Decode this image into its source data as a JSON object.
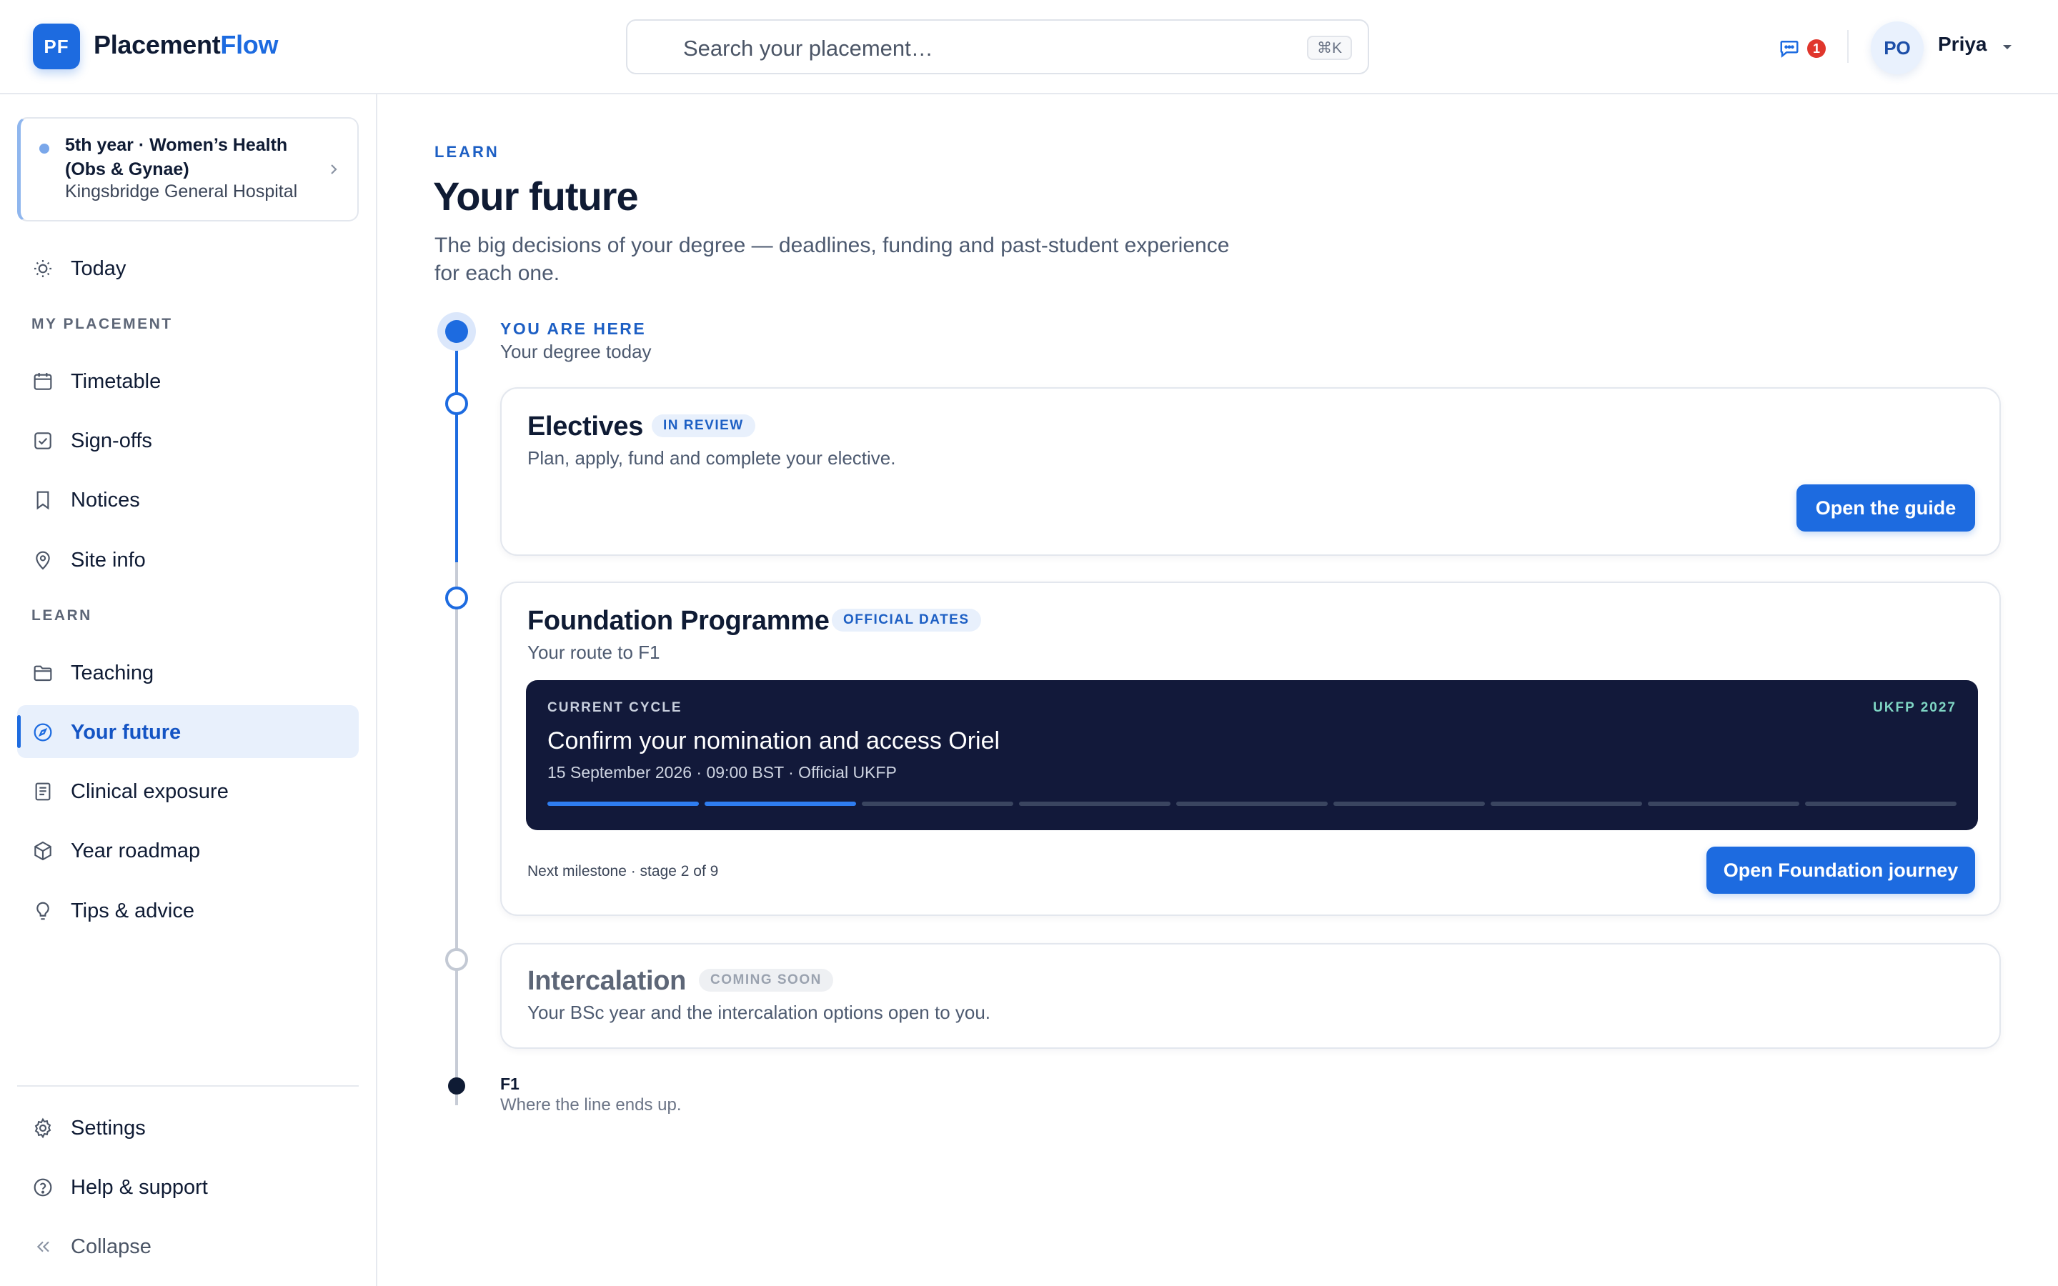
{
  "brand": {
    "badge": "PF",
    "name_part1": "Placement",
    "name_part2": "Flow",
    "accent": "#1d6be0"
  },
  "search": {
    "placeholder": "Search your placement…",
    "shortcut": "⌘K"
  },
  "header": {
    "messages_count": "1",
    "avatar_initials": "PO",
    "user_name": "Priya"
  },
  "sidebar": {
    "placement": {
      "title": "5th year · Women’s Health (Obs & Gynae)",
      "site": "Kingsbridge General Hospital"
    },
    "today": {
      "label": "Today",
      "icon": "sun-icon"
    },
    "section_placement": "MY PLACEMENT",
    "placement_items": [
      {
        "label": "Timetable",
        "icon": "calendar-icon"
      },
      {
        "label": "Sign-offs",
        "icon": "checkbox-icon"
      },
      {
        "label": "Notices",
        "icon": "bookmark-icon"
      },
      {
        "label": "Site info",
        "icon": "map-pin-icon"
      }
    ],
    "section_learn": "LEARN",
    "learn_items": [
      {
        "label": "Teaching",
        "icon": "folder-icon"
      },
      {
        "label": "Your future",
        "icon": "compass-icon",
        "active": true
      },
      {
        "label": "Clinical exposure",
        "icon": "document-icon"
      },
      {
        "label": "Year roadmap",
        "icon": "cube-icon"
      },
      {
        "label": "Tips & advice",
        "icon": "lightbulb-icon"
      }
    ],
    "footer_items": [
      {
        "label": "Settings",
        "icon": "gear-icon"
      },
      {
        "label": "Help & support",
        "icon": "help-circle-icon"
      },
      {
        "label": "Collapse",
        "icon": "double-chevron-left-icon"
      }
    ]
  },
  "page": {
    "eyebrow": "LEARN",
    "title": "Your future",
    "subtitle": "The big decisions of your degree — deadlines, funding and past-student experience for each one."
  },
  "timeline": {
    "here_label": "YOU ARE HERE",
    "here_sub": "Your degree today",
    "electives": {
      "title": "Electives",
      "tag": "IN REVIEW",
      "subtitle": "Plan, apply, fund and complete your elective.",
      "button": "Open the guide"
    },
    "foundation": {
      "title": "Foundation Programme",
      "tag": "OFFICIAL DATES",
      "subtitle": "Your route to F1",
      "cycle_eyebrow": "CURRENT CYCLE",
      "cycle_tag": "UKFP 2027",
      "cycle_title": "Confirm your nomination and access Oriel",
      "cycle_meta": "15 September 2026 · 09:00 BST · Official UKFP",
      "progress_completed": 2,
      "progress_total": 9,
      "milestone": "Next milestone · stage 2 of 9",
      "button": "Open Foundation journey"
    },
    "intercalation": {
      "title": "Intercalation",
      "tag": "COMING SOON",
      "subtitle": "Your BSc year and the intercalation options open to you."
    },
    "end": {
      "title": "F1",
      "subtitle": "Where the line ends up."
    }
  }
}
